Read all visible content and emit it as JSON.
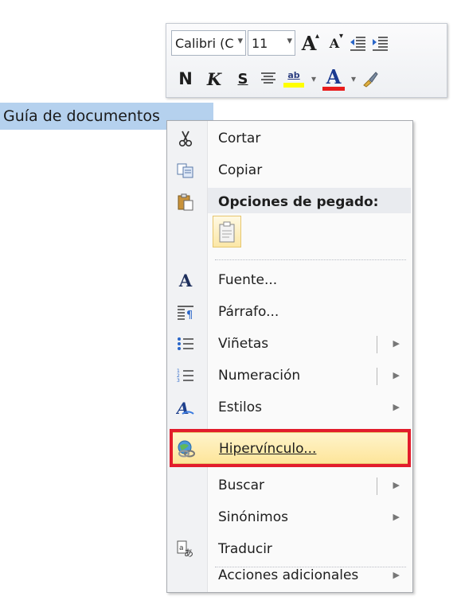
{
  "document": {
    "selected_text": "Guía de documentos"
  },
  "mini_toolbar": {
    "font_name": "Calibri (C",
    "font_size": "11",
    "grow_font_glyph": "A",
    "shrink_font_glyph": "A",
    "bold_glyph": "N",
    "italic_glyph": "K",
    "underline_glyph": "S",
    "highlight_glyph": "ab",
    "font_color_glyph": "A",
    "colors": {
      "highlight": "#ffff00",
      "font_color": "#e81c1c"
    }
  },
  "context_menu": {
    "items": [
      {
        "label": "Cortar",
        "icon": "scissors-icon"
      },
      {
        "label": "Copiar",
        "icon": "copy-icon"
      },
      {
        "label": "Opciones de pegado:",
        "icon": "paste-icon"
      },
      {
        "label": "Fuente...",
        "icon": "font-icon"
      },
      {
        "label": "Párrafo...",
        "icon": "paragraph-icon"
      },
      {
        "label": "Viñetas",
        "icon": "bullets-icon"
      },
      {
        "label": "Numeración",
        "icon": "numbering-icon"
      },
      {
        "label": "Estilos",
        "icon": "styles-icon"
      },
      {
        "label": "Hipervínculo...",
        "icon": "hyperlink-icon"
      },
      {
        "label": "Buscar",
        "icon": ""
      },
      {
        "label": "Sinónimos",
        "icon": ""
      },
      {
        "label": "Traducir",
        "icon": "translate-icon"
      },
      {
        "label": "Acciones adicionales",
        "icon": ""
      }
    ],
    "highlight_color": "#e21c2c"
  }
}
